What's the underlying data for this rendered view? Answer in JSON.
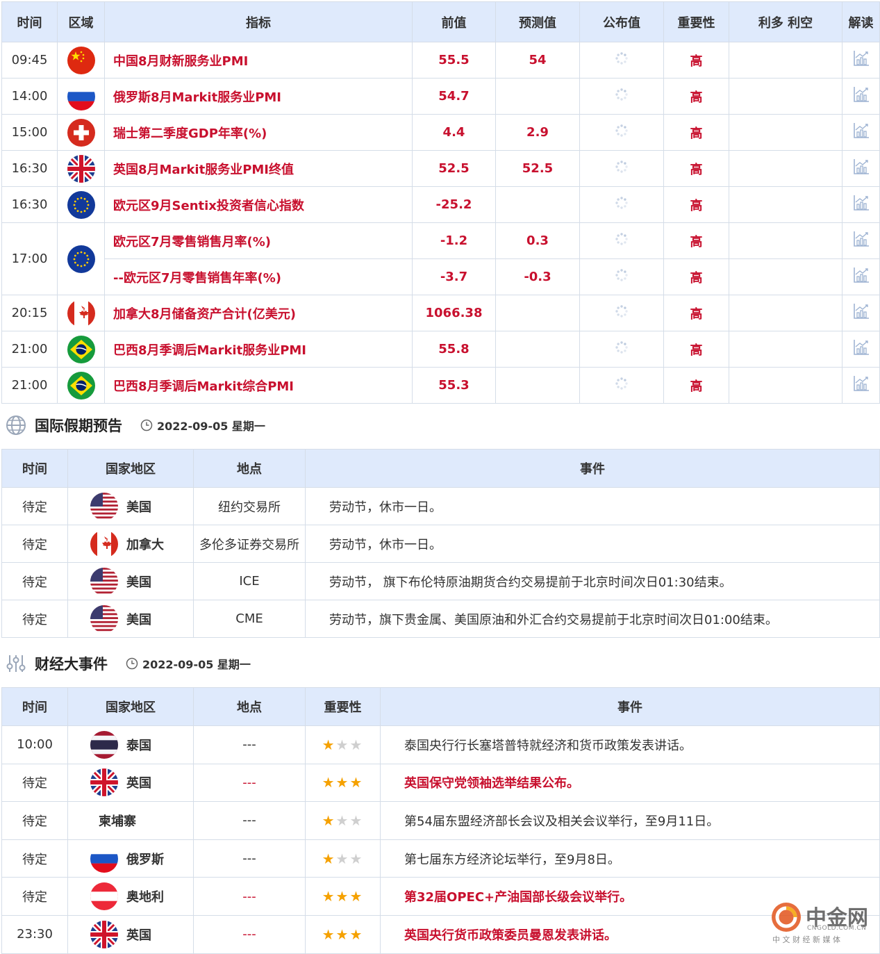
{
  "calendar": {
    "headers": [
      "时间",
      "区域",
      "指标",
      "前值",
      "预测值",
      "公布值",
      "重要性",
      "利多 利空",
      "解读"
    ],
    "rows": [
      {
        "time": "09:45",
        "flag": "cn",
        "indicator": "中国8月财新服务业PMI",
        "prev": "55.5",
        "forecast": "54",
        "importance": "高"
      },
      {
        "time": "14:00",
        "flag": "ru",
        "indicator": "俄罗斯8月Markit服务业PMI",
        "prev": "54.7",
        "forecast": "",
        "importance": "高"
      },
      {
        "time": "15:00",
        "flag": "ch",
        "indicator": "瑞士第二季度GDP年率(%)",
        "prev": "4.4",
        "forecast": "2.9",
        "importance": "高"
      },
      {
        "time": "16:30",
        "flag": "gb",
        "indicator": "英国8月Markit服务业PMI终值",
        "prev": "52.5",
        "forecast": "52.5",
        "importance": "高"
      },
      {
        "time": "16:30",
        "flag": "eu",
        "indicator": "欧元区9月Sentix投资者信心指数",
        "prev": "-25.2",
        "forecast": "",
        "importance": "高"
      },
      {
        "time": "17:00",
        "flag": "eu",
        "indicator": "欧元区7月零售销售月率(%)",
        "prev": "-1.2",
        "forecast": "0.3",
        "importance": "高"
      },
      {
        "time": "",
        "flag": "",
        "indicator": "--欧元区7月零售销售年率(%)",
        "prev": "-3.7",
        "forecast": "-0.3",
        "importance": "高"
      },
      {
        "time": "20:15",
        "flag": "ca",
        "indicator": "加拿大8月储备资产合计(亿美元)",
        "prev": "1066.38",
        "forecast": "",
        "importance": "高"
      },
      {
        "time": "21:00",
        "flag": "br",
        "indicator": "巴西8月季调后Markit服务业PMI",
        "prev": "55.8",
        "forecast": "",
        "importance": "高"
      },
      {
        "time": "21:00",
        "flag": "br",
        "indicator": "巴西8月季调后Markit综合PMI",
        "prev": "55.3",
        "forecast": "",
        "importance": "高"
      }
    ]
  },
  "holiday_section": {
    "title": "国际假期预告",
    "date": "2022-09-05 星期一"
  },
  "holiday": {
    "headers": [
      "时间",
      "国家地区",
      "地点",
      "事件"
    ],
    "rows": [
      {
        "time": "待定",
        "flag": "us",
        "country": "美国",
        "place": "纽约交易所",
        "event": "劳动节，休市一日。"
      },
      {
        "time": "待定",
        "flag": "ca",
        "country": "加拿大",
        "place": "多伦多证券交易所",
        "event": "劳动节，休市一日。"
      },
      {
        "time": "待定",
        "flag": "us",
        "country": "美国",
        "place": "ICE",
        "event": "劳动节， 旗下布伦特原油期货合约交易提前于北京时间次日01:30结束。"
      },
      {
        "time": "待定",
        "flag": "us",
        "country": "美国",
        "place": "CME",
        "event": "劳动节，旗下贵金属、美国原油和外汇合约交易提前于北京时间次日01:00结束。"
      }
    ]
  },
  "events_section": {
    "title": "财经大事件",
    "date": "2022-09-05 星期一"
  },
  "events": {
    "headers": [
      "时间",
      "国家地区",
      "地点",
      "重要性",
      "事件"
    ],
    "rows": [
      {
        "time": "10:00",
        "flag": "th",
        "country": "泰国",
        "place": "---",
        "stars": 1,
        "event": "泰国央行行长塞塔普特就经济和货币政策发表讲话。",
        "highlight": false
      },
      {
        "time": "待定",
        "flag": "gb",
        "country": "英国",
        "place": "---",
        "stars": 3,
        "event": "英国保守党领袖选举结果公布。",
        "highlight": true
      },
      {
        "time": "待定",
        "flag": "",
        "country": "柬埔寨",
        "place": "---",
        "stars": 1,
        "event": "第54届东盟经济部长会议及相关会议举行，至9月11日。",
        "highlight": false
      },
      {
        "time": "待定",
        "flag": "ru",
        "country": "俄罗斯",
        "place": "---",
        "stars": 1,
        "event": "第七届东方经济论坛举行，至9月8日。",
        "highlight": false
      },
      {
        "time": "待定",
        "flag": "at",
        "country": "奥地利",
        "place": "---",
        "stars": 3,
        "event": "第32届OPEC+产油国部长级会议举行。",
        "highlight": true
      },
      {
        "time": "23:30",
        "flag": "gb",
        "country": "英国",
        "place": "---",
        "stars": 3,
        "event": "英国央行货币政策委员曼恩发表讲话。",
        "highlight": true
      }
    ]
  },
  "logo": {
    "name": "中金网",
    "domain": "CNGOLD.COM.CN",
    "tagline": "中 文 财 经 新 媒 体"
  },
  "colors": {
    "accent_red": "#c8102e",
    "header_bg": "#dfeafc",
    "star": "#f5a100"
  }
}
